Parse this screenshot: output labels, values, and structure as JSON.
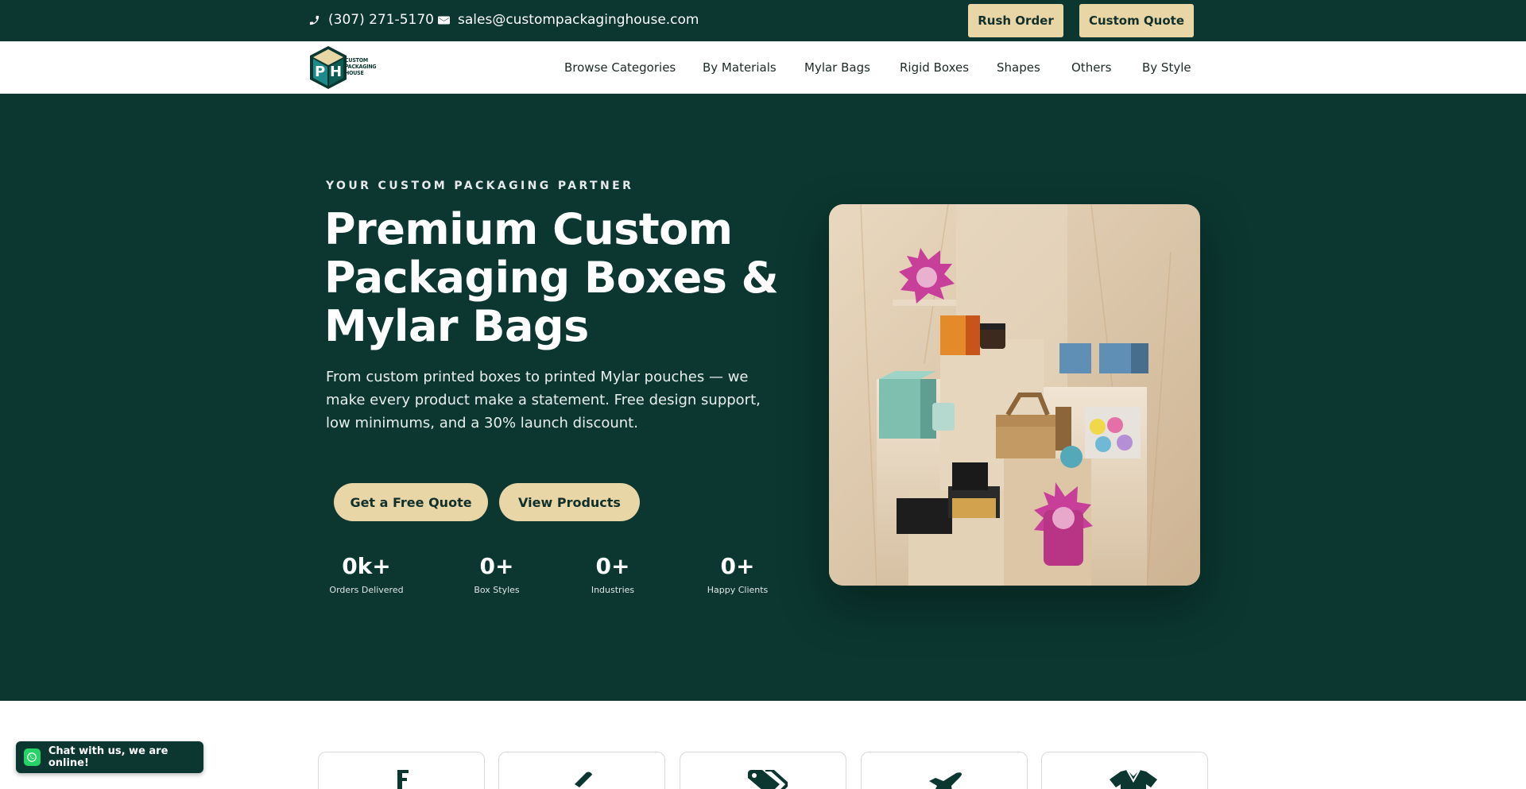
{
  "topbar": {
    "phone": "(307) 271-5170",
    "email": "sales@custompackaginghouse.com",
    "rush_order_label": "Rush Order",
    "custom_quote_label": "Custom Quote"
  },
  "logo": {
    "text_line1": "CUSTOM",
    "text_line2": "PACKAGING",
    "text_line3": "HOUSE"
  },
  "nav": {
    "items": [
      "Browse Categories",
      "By Materials",
      "Mylar Bags",
      "Rigid Boxes",
      "Shapes",
      "Others",
      "By Style"
    ]
  },
  "hero": {
    "eyebrow": "YOUR CUSTOM PACKAGING PARTNER",
    "headline_line1": "Premium Custom",
    "headline_line2": "Packaging Boxes &",
    "headline_line3": "Mylar Bags",
    "subtext": "From custom printed boxes to printed Mylar pouches — we make every product make a statement. Free design support, low minimums, and a 30% launch discount.",
    "primary_cta": "Get a Free Quote",
    "secondary_cta": "View Products",
    "stats": [
      {
        "value": "0k+",
        "label": "Orders Delivered"
      },
      {
        "value": "0+",
        "label": "Box Styles"
      },
      {
        "value": "0+",
        "label": "Industries"
      },
      {
        "value": "0+",
        "label": "Happy Clients"
      }
    ]
  },
  "chat": {
    "label": "Chat with us, we are online!"
  },
  "colors": {
    "brand_dark": "#0b3730",
    "accent_tan": "#e8d6a6",
    "whatsapp_green": "#25d366"
  },
  "icons": [
    "phone-icon",
    "mail-icon",
    "whatsapp-icon",
    "list-icon",
    "brush-icon",
    "tag-icon",
    "plane-icon",
    "shirt-icon"
  ]
}
